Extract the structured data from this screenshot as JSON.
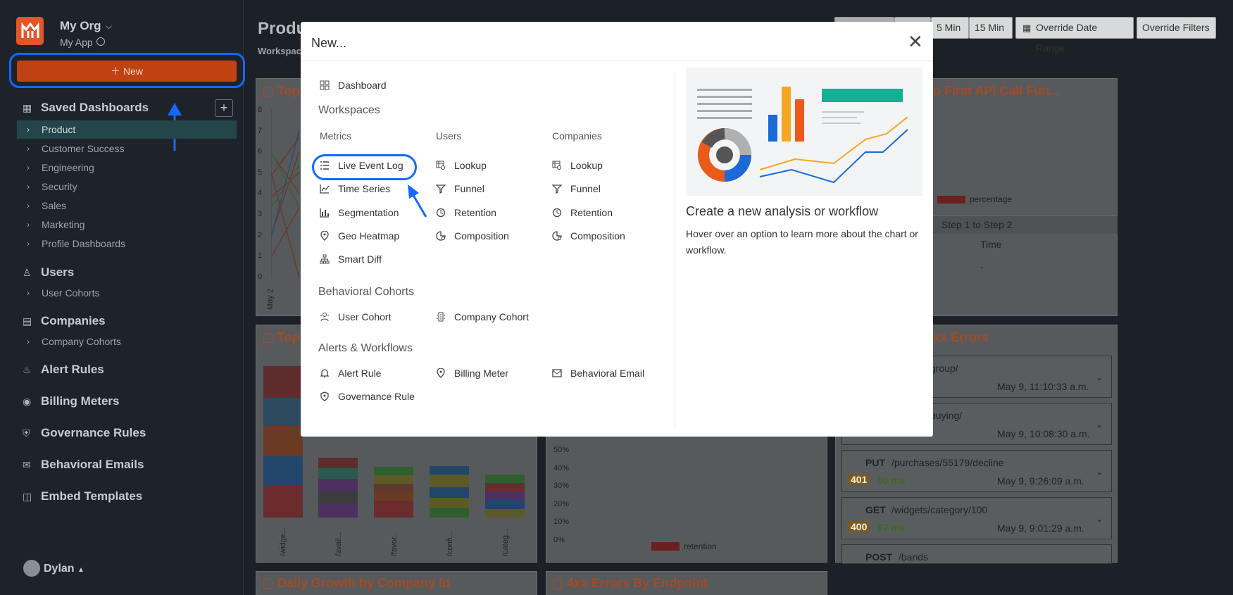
{
  "sidebar": {
    "org_name": "My Org",
    "app_name": "My App",
    "new_button": "New",
    "saved_dashboards": "Saved Dashboards",
    "dashboards": [
      "Product",
      "Customer Success",
      "Engineering",
      "Security",
      "Sales",
      "Marketing",
      "Profile Dashboards"
    ],
    "users": "Users",
    "user_cohorts": "User Cohorts",
    "companies": "Companies",
    "company_cohorts": "Company Cohorts",
    "alert_rules": "Alert Rules",
    "billing_meters": "Billing Meters",
    "governance_rules": "Governance Rules",
    "behavioral_emails": "Behavioral Emails",
    "embed_templates": "Embed Templates",
    "user_name": "Dylan"
  },
  "main": {
    "title": "Produ",
    "subtitle": "Workspac",
    "toolbar": [
      "5 Min",
      "15 Min",
      "Override Date Range",
      "Override Filters"
    ],
    "panel_titles": [
      "Top",
      "Top",
      "Daily Growth by Company Id",
      "4xx Errors By Endpoint",
      "o First API Call Fun...",
      "xx Errors"
    ],
    "funnel_legend": "percentage",
    "funnel_header": "Step 1 to Step 2",
    "funnel_col": "Time",
    "funnel_val": "-",
    "y_ticks": [
      "8",
      "7",
      "6",
      "5",
      "4",
      "3",
      "2",
      "1",
      "0"
    ],
    "x_date": "May 2",
    "bar_x_labels": [
      "/widge...",
      "/avail...",
      "/favor...",
      "/confi...",
      "/categ..."
    ],
    "pct_ticks": [
      "50%",
      "40%",
      "30%",
      "20%",
      "10%",
      "0%"
    ],
    "retention_legend": "retention",
    "errors": [
      {
        "method": "",
        "path": "group/",
        "status": "",
        "latency": "",
        "time": "May 9, 11:10:33 a.m."
      },
      {
        "method": "",
        "path": "buying/",
        "status": "",
        "latency": "",
        "time": "May 9, 10:08:30 a.m."
      },
      {
        "method": "PUT",
        "path": "/purchases/55179/decline",
        "status": "401",
        "latency": "50 ms",
        "time": "May 9, 9:26:09 a.m."
      },
      {
        "method": "GET",
        "path": "/widgets/category/100",
        "status": "400",
        "latency": "67 ms",
        "time": "May 9, 9:01:29 a.m."
      },
      {
        "method": "POST",
        "path": "/bands",
        "status": "",
        "latency": "",
        "time": ""
      }
    ]
  },
  "modal": {
    "title": "New...",
    "dashboard": "Dashboard",
    "workspaces": "Workspaces",
    "metrics_header": "Metrics",
    "users_header": "Users",
    "companies_header": "Companies",
    "metrics": [
      "Live Event Log",
      "Time Series",
      "Segmentation",
      "Geo Heatmap",
      "Smart Diff"
    ],
    "users": [
      "Lookup",
      "Funnel",
      "Retention",
      "Composition"
    ],
    "companies": [
      "Lookup",
      "Funnel",
      "Retention",
      "Composition"
    ],
    "behavioral_cohorts": "Behavioral Cohorts",
    "cohorts": [
      "User Cohort",
      "Company Cohort"
    ],
    "alerts_workflows": "Alerts & Workflows",
    "alerts": [
      "Alert Rule",
      "Billing Meter",
      "Behavioral Email",
      "Governance Rule"
    ],
    "info_title": "Create a new analysis or workflow",
    "info_desc": "Hover over an option to learn more about the chart or workflow."
  }
}
